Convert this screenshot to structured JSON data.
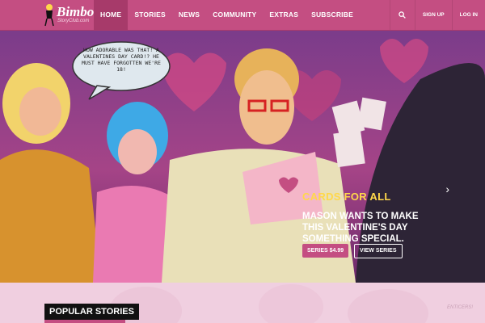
{
  "logo": {
    "text": "Bimbo",
    "subtext": "StoryClub.com"
  },
  "nav": {
    "items": [
      "HOME",
      "STORIES",
      "NEWS",
      "COMMUNITY",
      "EXTRAS",
      "SUBSCRIBE"
    ],
    "active": "HOME",
    "signup": "SIGN UP",
    "login": "LOG IN"
  },
  "hero": {
    "speech": "HOW ADORABLE WAS THAT! A VALENTINES DAY CARD!? HE MUST HAVE FORGOTTEN WE'RE 18!",
    "title": "CARDS FOR ALL",
    "description": "MASON WANTS TO MAKE THIS VALENTINE'S DAY SOMETHING SPECIAL.",
    "series_button": "SERIES $4.99",
    "view_button": "VIEW SERIES",
    "slide_count": 8,
    "active_slide": 1
  },
  "popular": {
    "title": "POPULAR STORIES",
    "watermark": "ENTICERS!"
  },
  "colors": {
    "brand": "#c44e82",
    "accent": "#ffd84a"
  }
}
